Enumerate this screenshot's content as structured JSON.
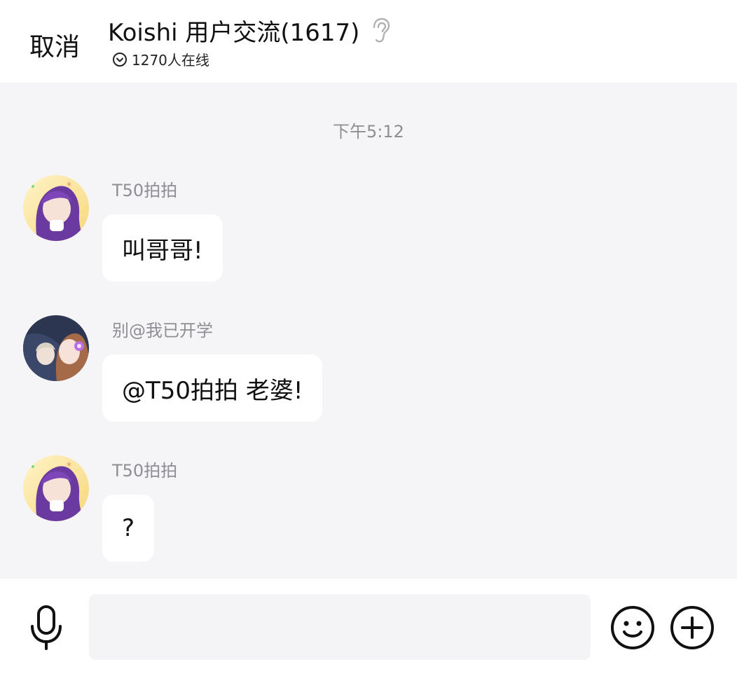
{
  "header": {
    "cancel_label": "取消",
    "title": "Koishi 用户交流(1617)",
    "online_text": "1270人在线",
    "icons": {
      "ear": "ear-icon",
      "online": "chevron-down-circle-icon"
    }
  },
  "chat": {
    "timestamp": "下午5:12",
    "messages": [
      {
        "sender": "T50拍拍",
        "text": "叫哥哥!",
        "avatar": "purple-hair-avatar"
      },
      {
        "sender": "别@我已开学",
        "text": "@T50拍拍 老婆!",
        "avatar": "anime-group-avatar"
      },
      {
        "sender": "T50拍拍",
        "text": "?",
        "avatar": "purple-hair-avatar"
      }
    ]
  },
  "input_bar": {
    "input_value": "",
    "icons": {
      "voice": "microphone-icon",
      "emoji": "smiley-icon",
      "more": "plus-circle-icon"
    }
  },
  "colors": {
    "background": "#f5f5f7",
    "header": "#ffffff",
    "bubble": "#ffffff",
    "muted_text": "#8e8e93",
    "primary_text": "#111111"
  }
}
